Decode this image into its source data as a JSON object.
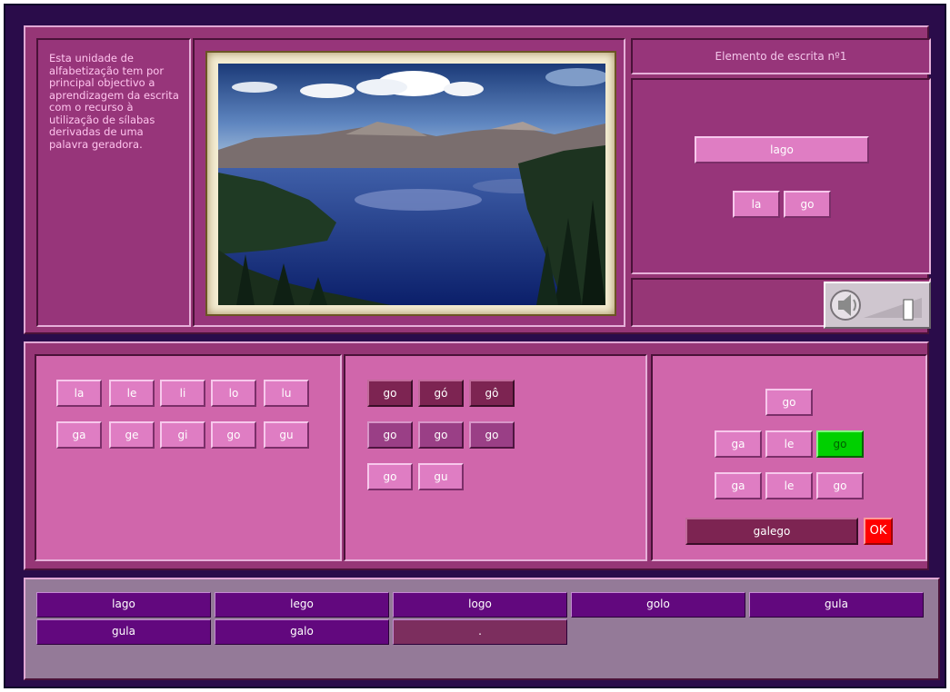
{
  "intro": {
    "text": "Esta unidade de alfabetização tem por principal objectivo a aprendizagem da escrita com o recurso à utilização de sílabas derivadas de uma palavra geradora."
  },
  "header": {
    "title": "Elemento de escrita nº1"
  },
  "target": {
    "word": "lago",
    "syllables": [
      "la",
      "go"
    ]
  },
  "syllable_grid": {
    "row1": [
      "la",
      "le",
      "li",
      "lo",
      "lu"
    ],
    "row2": [
      "ga",
      "ge",
      "gi",
      "go",
      "gu"
    ]
  },
  "variants": {
    "row1": [
      "go",
      "gó",
      "gô"
    ],
    "row2": [
      "go",
      "go",
      "go"
    ],
    "row3": [
      "go",
      "gu"
    ]
  },
  "composer": {
    "top": "go",
    "row1": [
      "ga",
      "le",
      "go"
    ],
    "row2": [
      "ga",
      "le",
      "go"
    ],
    "result": "galego",
    "ok_label": "OK"
  },
  "word_list": {
    "row1": [
      "lago",
      "lego",
      "logo",
      "golo",
      "gula"
    ],
    "row2": [
      "gula",
      "galo",
      "."
    ]
  },
  "colors": {
    "frame": "#2a0c4a",
    "panel": "#963676",
    "button_pink": "#df7dc3",
    "word_purple": "#62087e",
    "selected": "#00d000",
    "ok": "#ff0000"
  }
}
